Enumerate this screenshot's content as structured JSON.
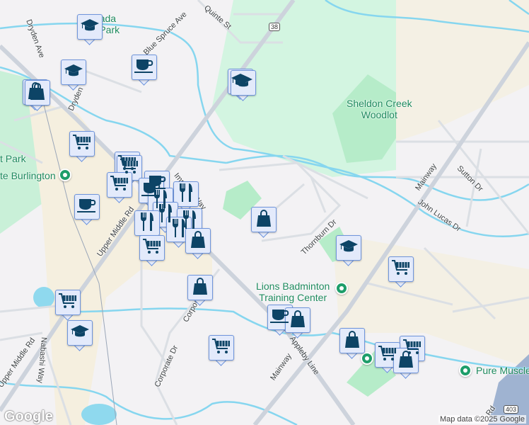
{
  "streets": {
    "dryden_ave": "Dryden Ave",
    "dryden_2": "Dryden",
    "blue_spruce": "Blue Spruce Ave",
    "quinte": "Quinte St",
    "imperial": "Imperial Way",
    "upper_middle_1": "Upper Middle Rd",
    "upper_middle_2": "Upper Middle Rd",
    "corporate_1": "Corporate Dr",
    "corporate_2": "Corporate Dr",
    "mainway_1": "Mainway",
    "mainway_2": "Mainway",
    "appleby": "Appleby Line",
    "thornburn": "Thornburn Dr",
    "sutton": "Sutton Dr",
    "john_lucas": "John Lucas Dr",
    "nabashi": "Nabashi Way",
    "rd_403": "Rd"
  },
  "shields": {
    "r38": "38",
    "r403": "403"
  },
  "pois": {
    "park_top": "Canada\nHills Park",
    "sheldon": "Sheldon Creek\nWoodlot",
    "park_left": "t Park",
    "burlington": "te Burlington",
    "lions": "Lions Badminton\nTraining Center",
    "pure_muscle": "Pure Muscle"
  },
  "footer": {
    "logo": "Google",
    "attribution": "Map data ©2025 Google"
  }
}
